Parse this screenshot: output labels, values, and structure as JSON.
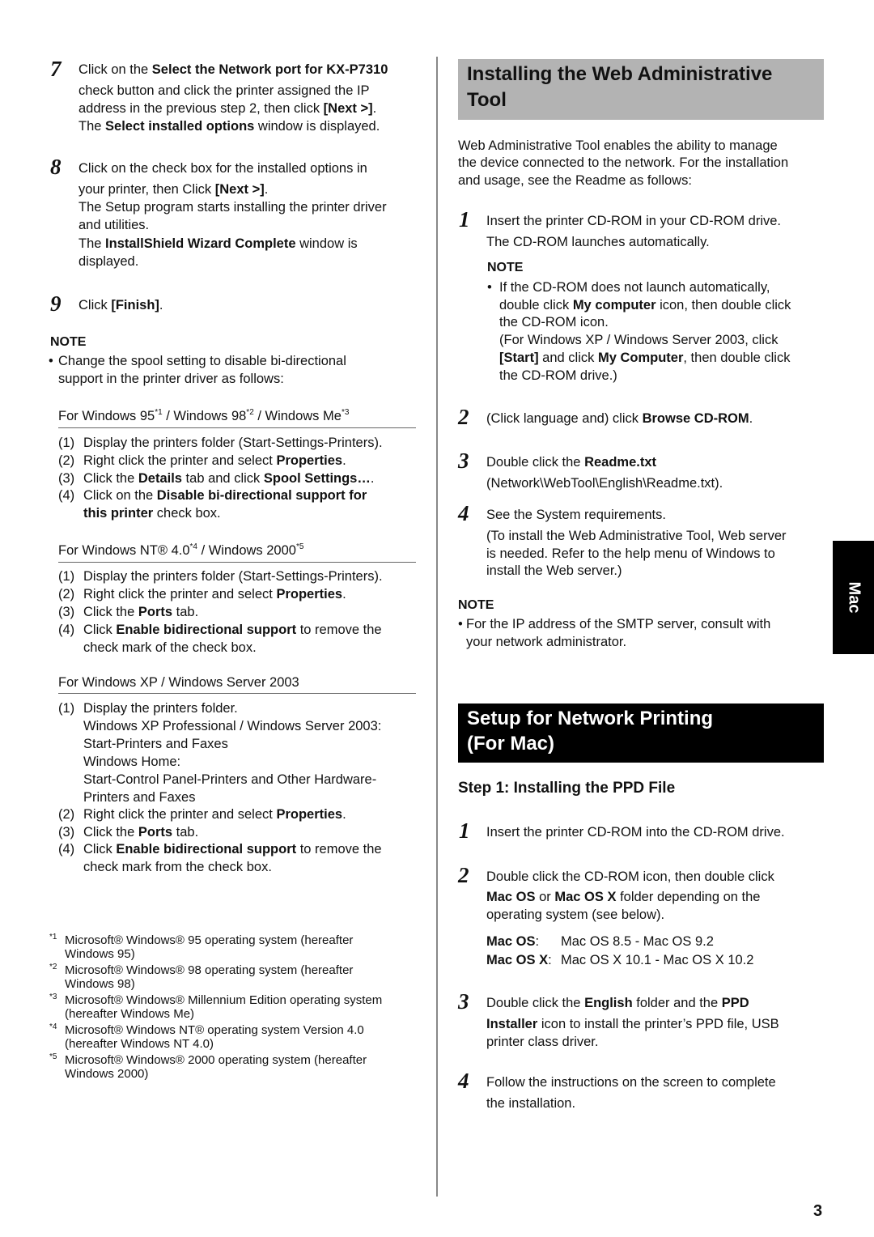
{
  "left": {
    "step7": {
      "num": "7",
      "l1a": "Click on the ",
      "l1b": "Select the Network port for KX-P7310",
      "l2": "check button and click the printer assigned the IP",
      "l3a": "address in the previous step 2, then click ",
      "l3b": "[Next >]",
      "l3c": ".",
      "l4a": "The ",
      "l4b": "Select installed options",
      "l4c": " window is displayed."
    },
    "step8": {
      "num": "8",
      "l1": "Click on the check box for the installed options in",
      "l2a": "your printer, then Click ",
      "l2b": "[Next >]",
      "l2c": ".",
      "l3": "The Setup program starts installing the printer driver",
      "l4": "and utilities.",
      "l5a": "The ",
      "l5b": "InstallShield Wizard Complete",
      "l5c": " window is",
      "l6": "displayed."
    },
    "step9": {
      "num": "9",
      "a": "Click ",
      "b": "[Finish]",
      "c": "."
    },
    "note": {
      "heading": "NOTE",
      "bullet": "•",
      "l1": "Change the spool setting to disable bi-directional",
      "l2": "support in the printer driver as follows:"
    },
    "win9x": {
      "heading_a": "For Windows 95",
      "sup1": "*1",
      "heading_b": " / Windows 98",
      "sup2": "*2",
      "heading_c": " / Windows Me",
      "sup3": "*3",
      "items": [
        {
          "n": "(1)",
          "a": "Display the printers folder (Start-Settings-Printers)."
        },
        {
          "n": "(2)",
          "a": "Right click the printer and select ",
          "b": "Properties",
          "c": "."
        },
        {
          "n": "(3)",
          "a": "Click the ",
          "b": "Details",
          "c": " tab and click ",
          "d": "Spool Settings…",
          "e": "."
        },
        {
          "n": "(4)",
          "a": "Click on the ",
          "b": "Disable bi-directional support for",
          "b2": "this printer",
          "c": " check box."
        }
      ]
    },
    "winnt": {
      "heading_a": "For Windows NT® 4.0",
      "sup4": "*4",
      "heading_b": " / Windows 2000",
      "sup5": "*5",
      "items": [
        {
          "n": "(1)",
          "a": "Display the printers folder (Start-Settings-Printers)."
        },
        {
          "n": "(2)",
          "a": "Right click the printer and select ",
          "b": "Properties",
          "c": "."
        },
        {
          "n": "(3)",
          "a": "Click the ",
          "b": "Ports",
          "c": " tab."
        },
        {
          "n": "(4)",
          "a": "Click ",
          "b": "Enable bidirectional support",
          "c": " to remove the",
          "d": "check mark of the check box."
        }
      ]
    },
    "winxp": {
      "heading": "For Windows XP / Windows Server 2003",
      "items": [
        {
          "n": "(1)",
          "l1": "Display the printers folder.",
          "l2": "Windows XP Professional / Windows Server 2003:",
          "l3": "Start-Printers and Faxes",
          "l4": "Windows Home:",
          "l5": "Start-Control Panel-Printers and Other Hardware-",
          "l6": "Printers and Faxes"
        },
        {
          "n": "(2)",
          "a": "Right click the printer and select ",
          "b": "Properties",
          "c": "."
        },
        {
          "n": "(3)",
          "a": "Click the ",
          "b": "Ports",
          "c": " tab."
        },
        {
          "n": "(4)",
          "a": "Click ",
          "b": "Enable bidirectional support",
          "c": " to remove the",
          "d": "check mark from the check box."
        }
      ]
    },
    "footnotes": [
      {
        "m": "*1",
        "l1": "Microsoft® Windows® 95 operating system (hereafter",
        "l2": "Windows 95)"
      },
      {
        "m": "*2",
        "l1": "Microsoft® Windows® 98 operating system (hereafter",
        "l2": "Windows 98)"
      },
      {
        "m": "*3",
        "l1": "Microsoft® Windows® Millennium Edition operating system",
        "l2": "(hereafter Windows Me)"
      },
      {
        "m": "*4",
        "l1": "Microsoft® Windows NT® operating system Version 4.0",
        "l2": "(hereafter Windows NT 4.0)"
      },
      {
        "m": "*5",
        "l1": "Microsoft® Windows® 2000 operating system (hereafter",
        "l2": "Windows 2000)"
      }
    ]
  },
  "right": {
    "web_tool": {
      "title_l1": "Installing the Web Administrative",
      "title_l2": "Tool",
      "intro_l1": "Web Administrative Tool enables the ability to manage",
      "intro_l2": "the device connected to the network. For the installation",
      "intro_l3": "and usage, see the Readme as follows:",
      "step1": {
        "num": "1",
        "l1": "Insert the printer CD-ROM in your CD-ROM drive.",
        "l2": "The CD-ROM launches automatically."
      },
      "note1": {
        "heading": "NOTE",
        "bullet": "•",
        "l1": "If the CD-ROM does not launch automatically,",
        "l2a": "double click ",
        "l2b": "My computer",
        "l2c": " icon, then double click",
        "l3": "the CD-ROM icon.",
        "l4": "(For Windows XP / Windows Server 2003, click",
        "l5a": "[Start]",
        "l5b": " and click ",
        "l5c": "My Computer",
        "l5d": ", then double click",
        "l6": "the CD-ROM drive.)"
      },
      "step2": {
        "num": "2",
        "a": "(Click language and) click ",
        "b": "Browse CD-ROM",
        "c": "."
      },
      "step3": {
        "num": "3",
        "a": "Double click the ",
        "b": "Readme.txt",
        "l2": "(Network\\WebTool\\English\\Readme.txt)."
      },
      "step4": {
        "num": "4",
        "l1": "See the System requirements.",
        "l2": "(To install the Web Administrative Tool, Web server",
        "l3": "is needed. Refer to the help menu of Windows to",
        "l4": "install the Web server.)"
      },
      "note2": {
        "heading": "NOTE",
        "bullet": "•",
        "l1": "For the IP address of the SMTP server, consult with",
        "l2": "your network administrator."
      }
    },
    "mac": {
      "title_l1": "Setup for Network Printing",
      "title_l2": "(For Mac)",
      "step_heading": "Step 1:  Installing the PPD File",
      "step1": {
        "num": "1",
        "l1": "Insert the printer CD-ROM into the CD-ROM drive."
      },
      "step2": {
        "num": "2",
        "l1": "Double click the CD-ROM icon, then double click",
        "l2a": "Mac OS",
        "l2b": " or ",
        "l2c": "Mac OS X",
        "l2d": " folder depending on the",
        "l3": "operating system (see below).",
        "os1_label": "Mac OS",
        "os1_colon": ":",
        "os1_value": "Mac OS 8.5 - Mac OS 9.2",
        "os2_label": "Mac OS X",
        "os2_colon": ":",
        "os2_value": "Mac OS X 10.1 - Mac OS X 10.2"
      },
      "step3": {
        "num": "3",
        "l1a": "Double click the ",
        "l1b": "English",
        "l1c": " folder and the ",
        "l1d": "PPD",
        "l2a": "Installer",
        "l2b": " icon to install the printer’s PPD file, USB",
        "l3": "printer class driver."
      },
      "step4": {
        "num": "4",
        "l1": "Follow the instructions on the screen to complete",
        "l2": "the installation."
      }
    }
  },
  "side_tab": {
    "label": "Mac"
  },
  "page_number": "3"
}
